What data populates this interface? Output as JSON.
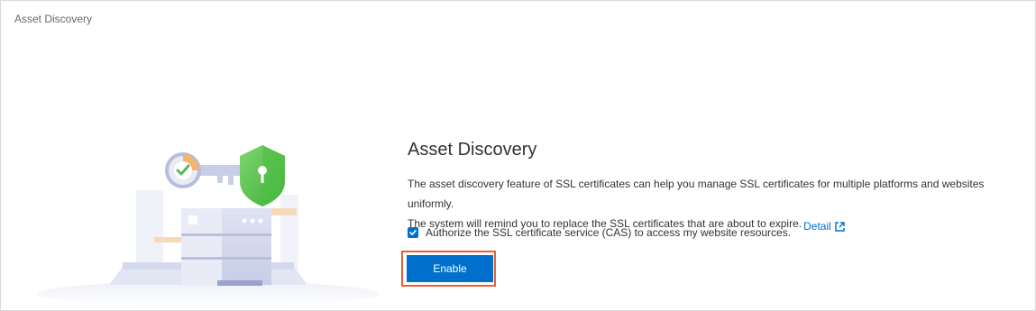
{
  "breadcrumb": {
    "label": "Asset Discovery"
  },
  "main": {
    "title": "Asset Discovery",
    "description_line1": "The asset discovery feature of SSL certificates can help you manage SSL certificates for multiple platforms and websites uniformly.",
    "description_line2": "The system will remind you to replace the SSL certificates that are about to expire.",
    "detail_link": "Detail",
    "detail_icon": "external-link-icon",
    "authorize_checkbox": {
      "label": "Authorize the SSL certificate service (CAS) to access my website resources.",
      "checked": true
    },
    "enable_button": "Enable"
  },
  "colors": {
    "primary": "#0070cc",
    "highlight_border": "#e5603a",
    "shield_green": "#5cb85c"
  }
}
